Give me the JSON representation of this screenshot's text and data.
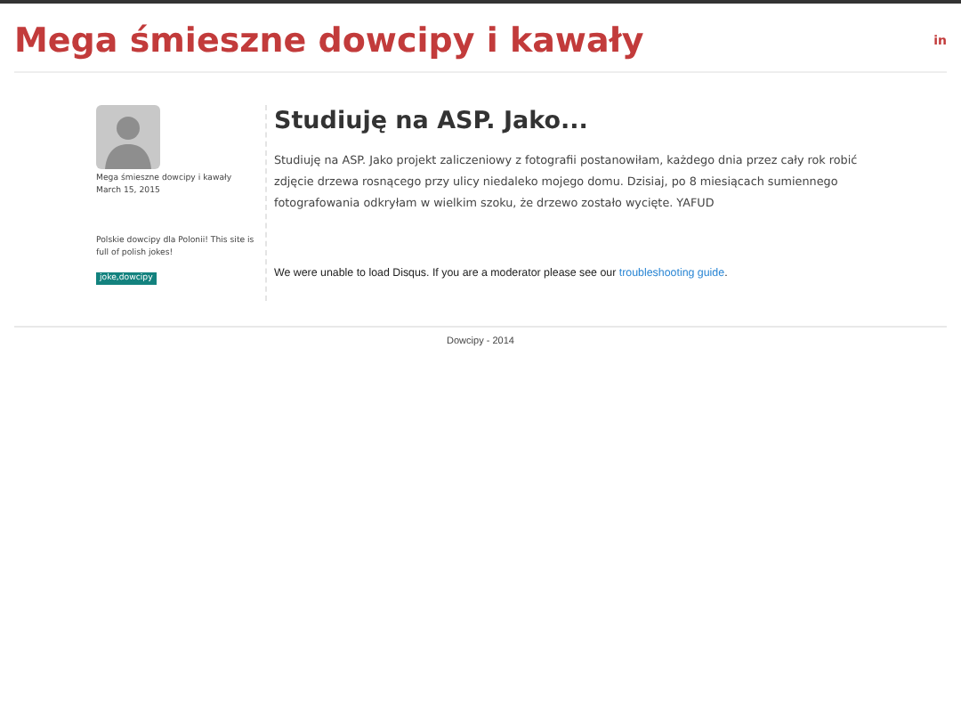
{
  "header": {
    "title": "Mega śmieszne dowcipy i kawały",
    "social_link": "in"
  },
  "sidebar": {
    "author": "Mega śmieszne dowcipy i kawały",
    "date": "March 15, 2015",
    "about": "Polskie dowcipy dla Polonii! This site is full of polish jokes!",
    "tag": "joke,dowcipy"
  },
  "post": {
    "title": "Studiuję na ASP. Jako...",
    "body": "Studiuję na ASP. Jako projekt zaliczeniowy z fotografii postanowiłam, każdego dnia przez cały rok robić zdjęcie drzewa rosnącego przy ulicy niedaleko mojego domu. Dzisiaj, po 8 miesiącach sumiennego fotografowania odkryłam w wielkim szoku, że drzewo zostało wycięte. YAFUD",
    "comments_notice": "We were unable to load Disqus. If you are a moderator please see our",
    "comments_link": "troubleshooting guide",
    "comments_end": "."
  },
  "footer": {
    "text": "Dowcipy - 2014"
  }
}
